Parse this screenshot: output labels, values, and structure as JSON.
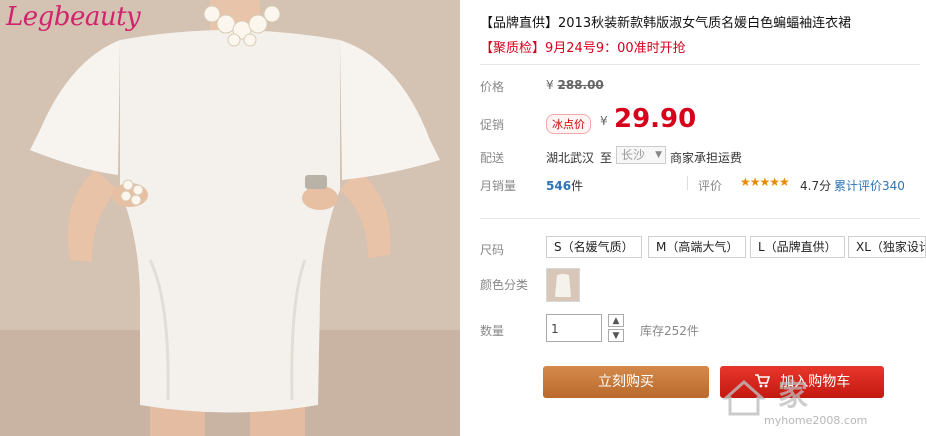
{
  "brand": "Legbeauty",
  "product": {
    "title": "【品牌直供】2013秋装新款韩版淑女气质名媛白色蝙蝠袖连衣裙",
    "subtitle": "【聚质检】9月24号9：00准时开抢"
  },
  "price": {
    "label": "价格",
    "currency": "¥",
    "original": "288.00",
    "promo_label": "促销",
    "promo_badge": "冰点价",
    "promo_value": "29.90"
  },
  "shipping": {
    "label": "配送",
    "from": "湖北武汉",
    "to_word": "至",
    "dest": "长沙",
    "note": "商家承担运费"
  },
  "sales": {
    "label": "月销量",
    "count": "546",
    "unit": "件",
    "rating_label": "评价",
    "stars": "★★★★★",
    "score": "4.7分",
    "reviews": "累计评价340"
  },
  "size": {
    "label": "尺码",
    "options": [
      "S（名媛气质）",
      "M（高端大气）",
      "L（品牌直供）",
      "XL（独家设计"
    ]
  },
  "color": {
    "label": "颜色分类"
  },
  "quantity": {
    "label": "数量",
    "value": "1",
    "stock": "库存252件"
  },
  "actions": {
    "buy_now": "立刻购买",
    "add_cart": "加入购物车"
  },
  "watermark": {
    "text": "家",
    "url": "myhome2008.com"
  },
  "colors": {
    "accent_red": "#d6001c",
    "buy_button": "#c77b3b",
    "cart_button": "#d9261c",
    "link_blue": "#2f73b5"
  }
}
